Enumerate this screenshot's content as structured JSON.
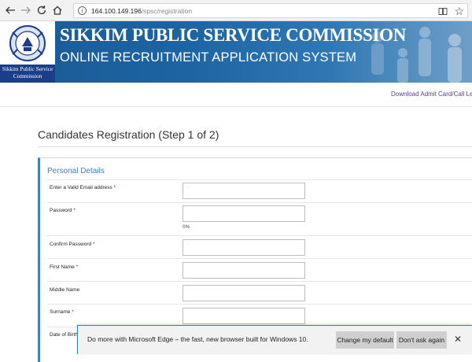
{
  "browser": {
    "url_host": "164.100.149.196",
    "url_path": "/spsc/registration",
    "icons": {
      "back": "back-arrow-icon",
      "forward": "forward-arrow-icon",
      "refresh": "refresh-icon",
      "home": "home-icon",
      "info": "info-icon",
      "reading": "reading-view-icon",
      "favorite": "star-icon"
    }
  },
  "banner": {
    "title": "SIKKIM PUBLIC SERVICE COMMISSION",
    "subtitle": "ONLINE RECRUITMENT APPLICATION SYSTEM",
    "logo_caption_line1": "Sikkim Public Service",
    "logo_caption_line2": "Commission",
    "colors": {
      "banner": "#1d64a3",
      "caption": "#1a3e8a"
    }
  },
  "top_link": "Download Admit Card/Call Letter",
  "page_heading": "Candidates Registration (Step 1 of 2)",
  "form": {
    "section_title": "Personal Details",
    "fields": [
      {
        "label": "Enter a Valid Email address",
        "required": "*",
        "value": ""
      },
      {
        "label": "Password",
        "required": "*",
        "value": ""
      },
      {
        "label": "Confirm Password",
        "required": "*",
        "value": ""
      },
      {
        "label": "First Name",
        "required": "*",
        "value": ""
      },
      {
        "label": "Middle Name",
        "required": "",
        "value": ""
      },
      {
        "label": "Surname",
        "required": "*",
        "value": ""
      },
      {
        "label": "Date of Birth",
        "required": "",
        "value": ""
      }
    ],
    "password_strength": "0%",
    "accent_color": "#3f7fc5"
  },
  "notification": {
    "message": "Do more with Microsoft Edge – the fast, new browser built for Windows 10.",
    "change_default_label": "Change my default",
    "dont_ask_label": "Don't ask again",
    "close_icon": "close-icon",
    "accent_color": "#2b7cd3"
  }
}
